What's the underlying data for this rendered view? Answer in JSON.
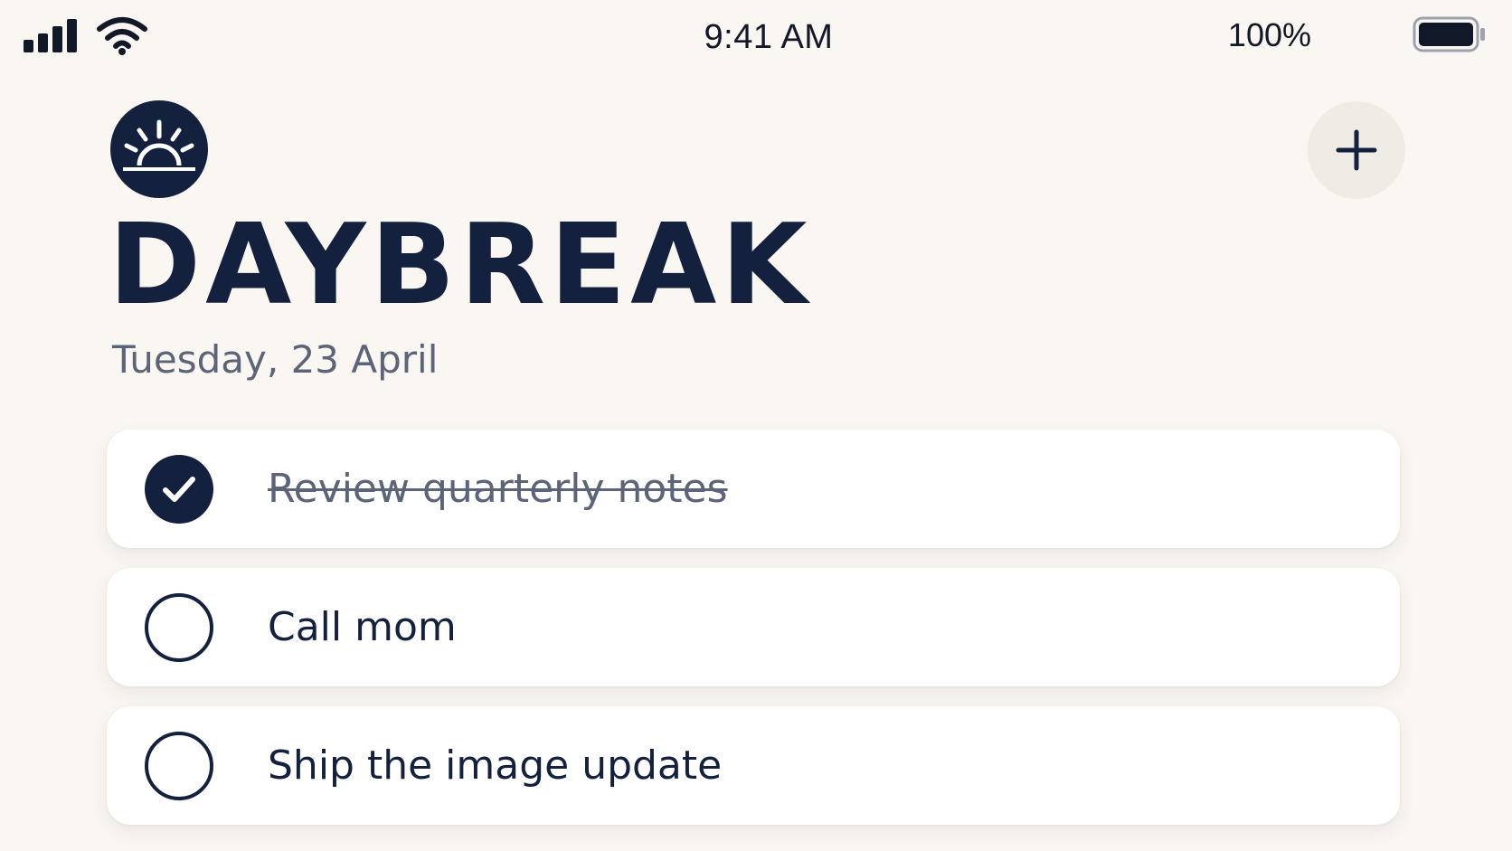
{
  "status_bar": {
    "time": "9:41 AM",
    "battery_percent": "100%",
    "battery_level": 1.0,
    "signal_icon": "cellular-signal-icon",
    "wifi_icon": "wifi-icon"
  },
  "header": {
    "logo_icon": "sunrise-icon",
    "add_icon": "plus-icon"
  },
  "app": {
    "title": "DAYBREAK",
    "date": "Tuesday, 23 April"
  },
  "tasks": [
    {
      "label": "Review quarterly notes",
      "done": true
    },
    {
      "label": "Call mom",
      "done": false
    },
    {
      "label": "Ship the image update",
      "done": false
    }
  ],
  "colors": {
    "background": "#faf6f1",
    "navy": "#13213f",
    "muted_text": "#5b6478",
    "card": "#ffffff",
    "add_button_bg": "#efebe5"
  }
}
